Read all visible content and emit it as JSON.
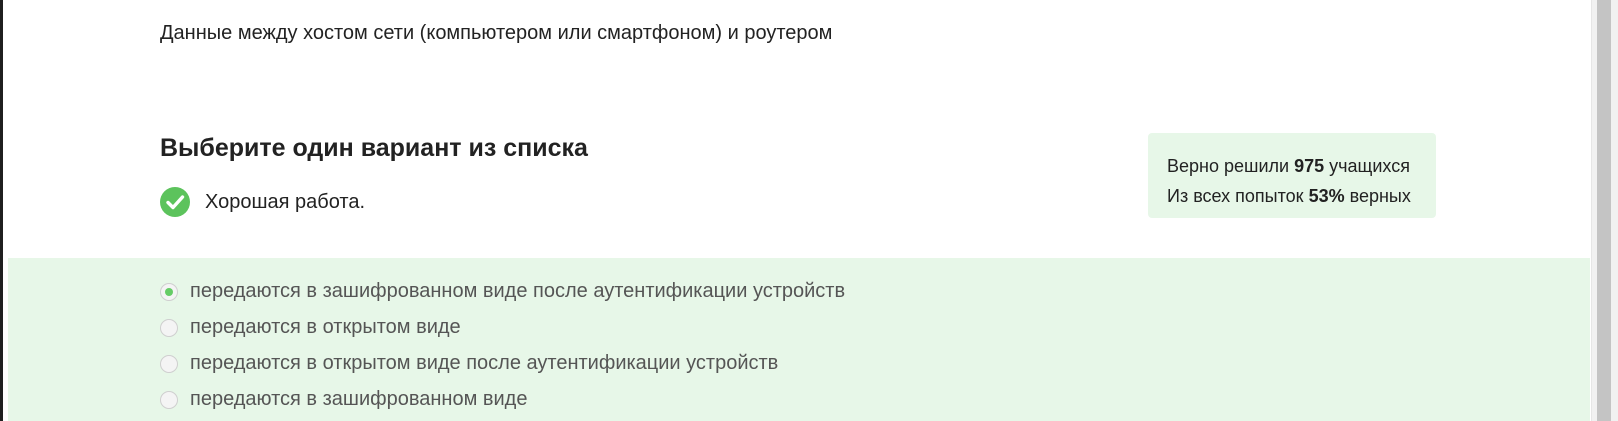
{
  "question": {
    "text": "Данные между хостом сети (компьютером или смартфоном) и роутером"
  },
  "section": {
    "title": "Выберите один вариант из списка"
  },
  "feedback": {
    "text": "Хорошая работа.",
    "icon": "check-circle-icon",
    "color": "#5cc35c"
  },
  "stats": {
    "line1_prefix": "Верно решили",
    "line1_count": "975",
    "line1_suffix": "учащихся",
    "line2_prefix": "Из всех попыток",
    "line2_percent": "53%",
    "line2_suffix": "верных",
    "background": "#e7f7e8"
  },
  "options": [
    {
      "label": "передаются в зашифрованном виде после аутентификации устройств",
      "selected": true
    },
    {
      "label": "передаются в открытом виде",
      "selected": false
    },
    {
      "label": "передаются в открытом виде после аутентификации устройств",
      "selected": false
    },
    {
      "label": "передаются в зашифрованном виде",
      "selected": false
    }
  ],
  "colors": {
    "panel_background": "#e7f7e8",
    "radio_checked": "#66cc66"
  }
}
